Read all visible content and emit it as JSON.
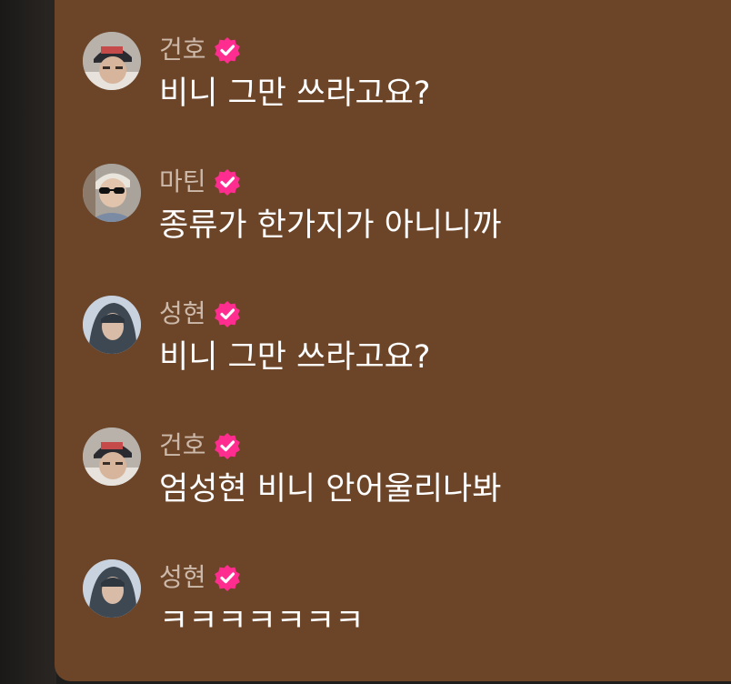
{
  "theme": {
    "panel_bg": "#6c4529",
    "badge_color": "#ff2d8f"
  },
  "messages": [
    {
      "user": "건호",
      "avatar": "avatar-geonho",
      "text": "비니 그만 쓰라고요?"
    },
    {
      "user": "마틴",
      "avatar": "avatar-martin",
      "text": "종류가 한가지가 아니니까"
    },
    {
      "user": "성현",
      "avatar": "avatar-seonghyeon",
      "text": "비니 그만 쓰라고요?"
    },
    {
      "user": "건호",
      "avatar": "avatar-geonho",
      "text": "엄성현 비니 안어울리나봐"
    },
    {
      "user": "성현",
      "avatar": "avatar-seonghyeon",
      "text": "ㅋㅋㅋㅋㅋㅋㅋ"
    }
  ],
  "icons": {
    "verified": "verified-badge-icon"
  }
}
